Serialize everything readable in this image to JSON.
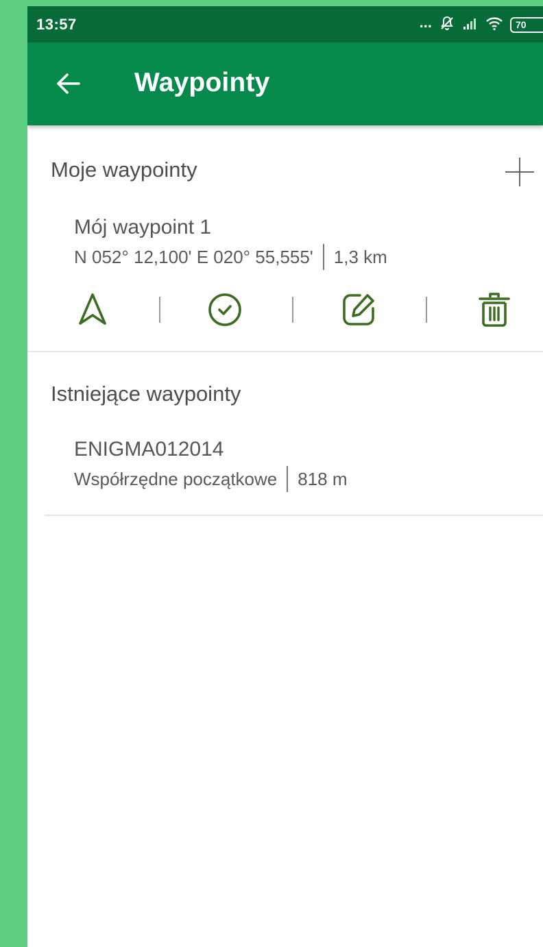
{
  "status_bar": {
    "time": "13:57",
    "dots": "...",
    "battery": "70",
    "icons": [
      "mute-icon",
      "signal-icon",
      "wifi-icon",
      "battery-icon"
    ]
  },
  "app_bar": {
    "title": "Waypointy",
    "back_icon": "arrow-left-icon"
  },
  "my_waypoints": {
    "title": "Moje waypointy",
    "add_icon": "plus-icon",
    "items": [
      {
        "name": "Mój waypoint 1",
        "coords": "N 052° 12,100' E 020° 55,555'",
        "distance": "1,3 km",
        "actions": [
          "navigate-icon",
          "check-circle-icon",
          "edit-icon",
          "trash-icon"
        ]
      }
    ]
  },
  "existing_waypoints": {
    "title": "Istniejące waypointy",
    "items": [
      {
        "name": "ENIGMA012014",
        "description": "Współrzędne początkowe",
        "distance": "818 m"
      }
    ]
  },
  "colors": {
    "status_bar": "#066b36",
    "app_bar": "#068a4b",
    "background_accent": "#5fcf81",
    "icon_green": "#3d6b21"
  }
}
